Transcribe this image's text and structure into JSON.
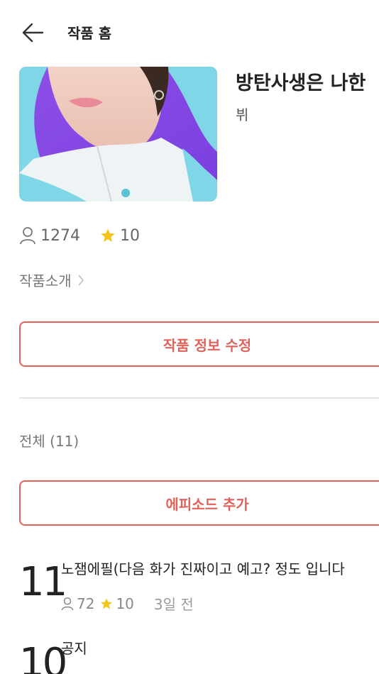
{
  "header": {
    "back_icon": "arrow-left-icon",
    "title": "작품 홈"
  },
  "work": {
    "title": "방탄사생은 나한",
    "author": "뷔",
    "views": "1274",
    "rating": "10",
    "intro_label": "작품소개",
    "colors": {
      "accent": "#e0625a",
      "star": "#f5c41c"
    }
  },
  "actions": {
    "edit_label": "작품 정보 수정",
    "add_episode_label": "에피소드 추가"
  },
  "list": {
    "section_title": "전체 (11)"
  },
  "episodes": [
    {
      "number": "11",
      "title": "노잼에필(다음 화가 진짜이고 예고? 정도 입니다",
      "views": "72",
      "rating": "10",
      "date": "3일 전"
    },
    {
      "number": "10",
      "title": "공지"
    }
  ]
}
